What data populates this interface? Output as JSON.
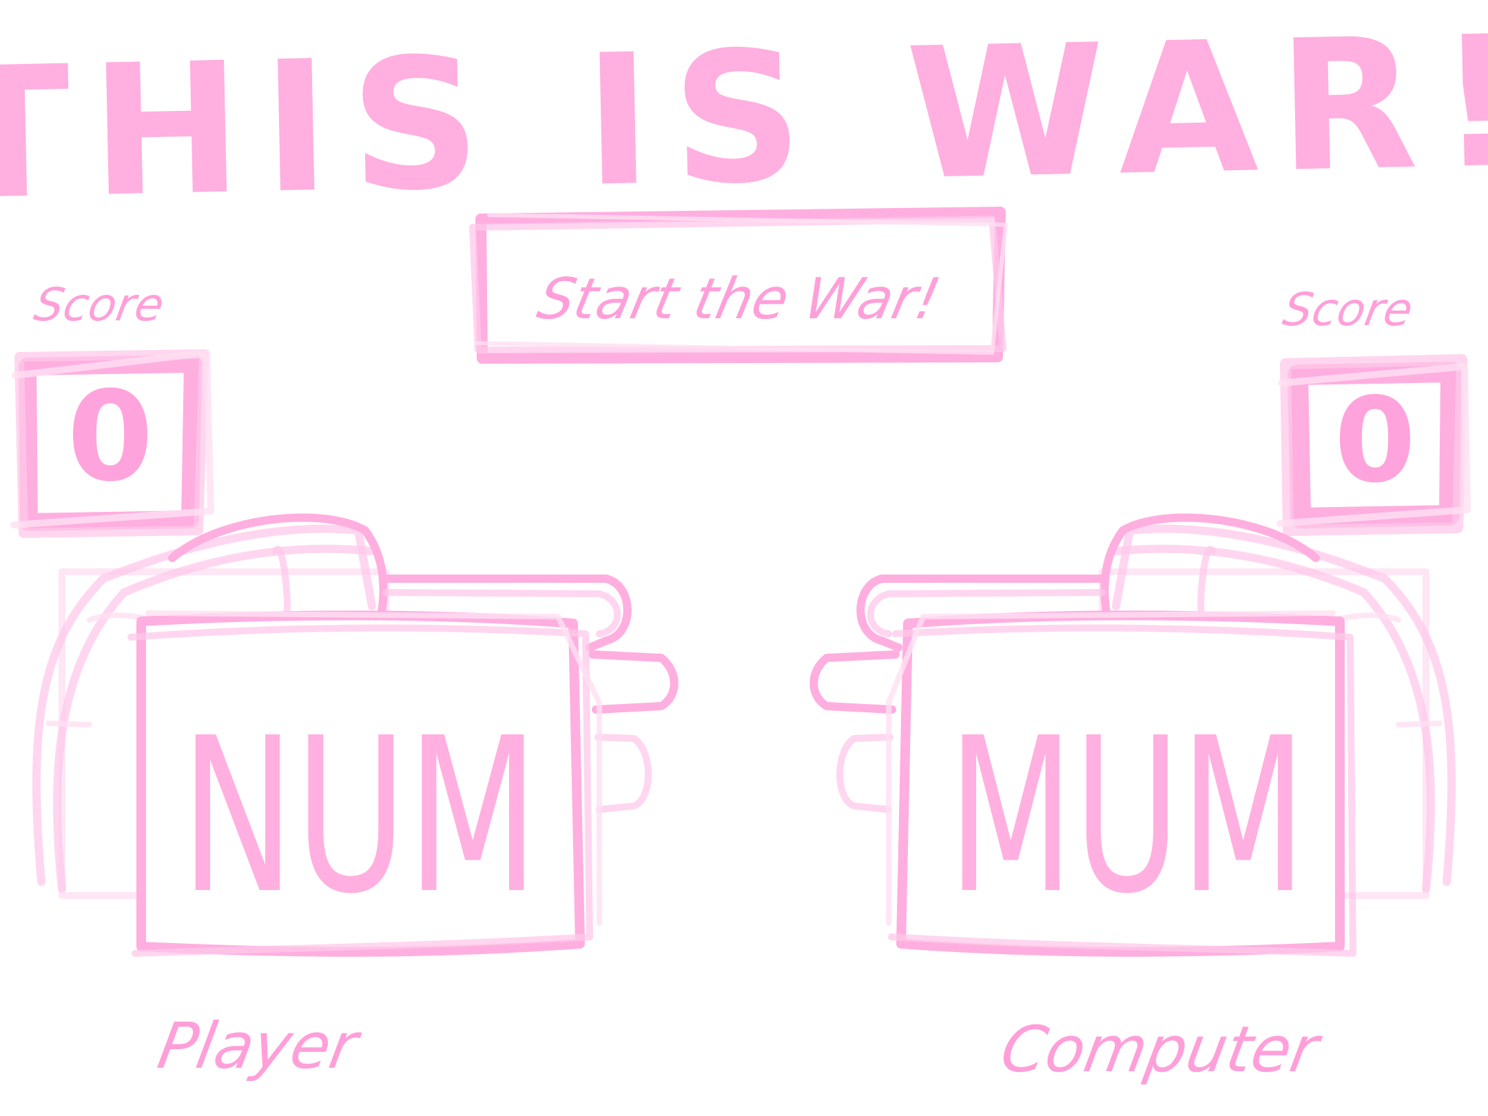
{
  "title": "THIS IS WAR!",
  "start_button": {
    "label": "Start the War!"
  },
  "player": {
    "score_label": "Score",
    "score": "0",
    "card": "NUM",
    "name": "Player"
  },
  "computer": {
    "score_label": "Score",
    "score": "0",
    "card": "MUM",
    "name": "Computer"
  },
  "colors": {
    "ink": "#ffaee0",
    "background": "#ffffff"
  }
}
